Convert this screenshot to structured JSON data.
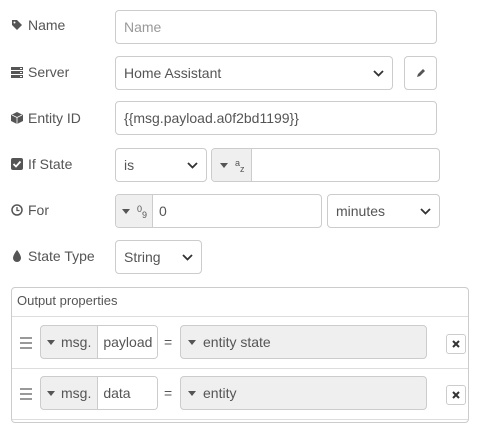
{
  "name": {
    "label": "Name",
    "placeholder": "Name",
    "value": ""
  },
  "server": {
    "label": "Server",
    "selected": "Home Assistant",
    "edit_icon": "pencil-icon"
  },
  "entity_id": {
    "label": "Entity ID",
    "value": "{{msg.payload.a0f2bd1199}}"
  },
  "if_state": {
    "label": "If State",
    "operator": "is",
    "value": ""
  },
  "for": {
    "label": "For",
    "value": "0",
    "unit": "minutes"
  },
  "state_type": {
    "label": "State Type",
    "selected": "String"
  },
  "output": {
    "title": "Output properties",
    "rows": [
      {
        "prefix": "msg.",
        "property": "payload",
        "equals": "=",
        "value": "entity state"
      },
      {
        "prefix": "msg.",
        "property": "data",
        "equals": "=",
        "value": "entity"
      }
    ]
  },
  "colors": {
    "border": "#cccccc",
    "label": "#555555",
    "placeholder": "#999999",
    "button_bg": "#efefef"
  }
}
